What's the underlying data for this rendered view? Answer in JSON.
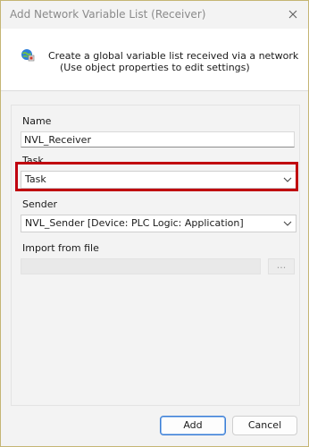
{
  "window": {
    "title": "Add Network Variable List (Receiver)"
  },
  "header": {
    "line1": "Create a global variable list received via a network",
    "line2": "(Use object properties to edit settings)",
    "icon": "network-globe-icon"
  },
  "form": {
    "name_label": "Name",
    "name_value": "NVL_Receiver",
    "task_label": "Task",
    "task_value": "Task",
    "sender_label": "Sender",
    "sender_value": "NVL_Sender [Device: PLC Logic: Application]",
    "import_label": "Import from file",
    "import_value": "",
    "browse_label": "..."
  },
  "buttons": {
    "add": "Add",
    "cancel": "Cancel"
  },
  "colors": {
    "highlight": "#c0000f",
    "primary_border": "#3a7dd6"
  }
}
